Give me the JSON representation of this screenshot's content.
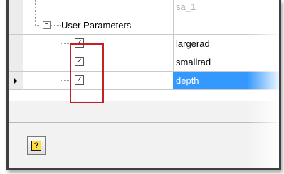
{
  "grid": {
    "top_row": {
      "value": "sa_1"
    },
    "group": {
      "expander": "−",
      "label": "User Parameters"
    },
    "rows": [
      {
        "value": "largerad",
        "checked": true,
        "checkmark": "✓"
      },
      {
        "value": "smallrad",
        "checked": true,
        "checkmark": "✓"
      },
      {
        "value": "depth",
        "checked": true,
        "checkmark": "✓",
        "selected": true
      }
    ]
  },
  "footer": {
    "help_icon": "help-icon",
    "help_glyph": "?"
  },
  "colors": {
    "selection": "#3399ff",
    "highlight_box": "#c42127"
  }
}
